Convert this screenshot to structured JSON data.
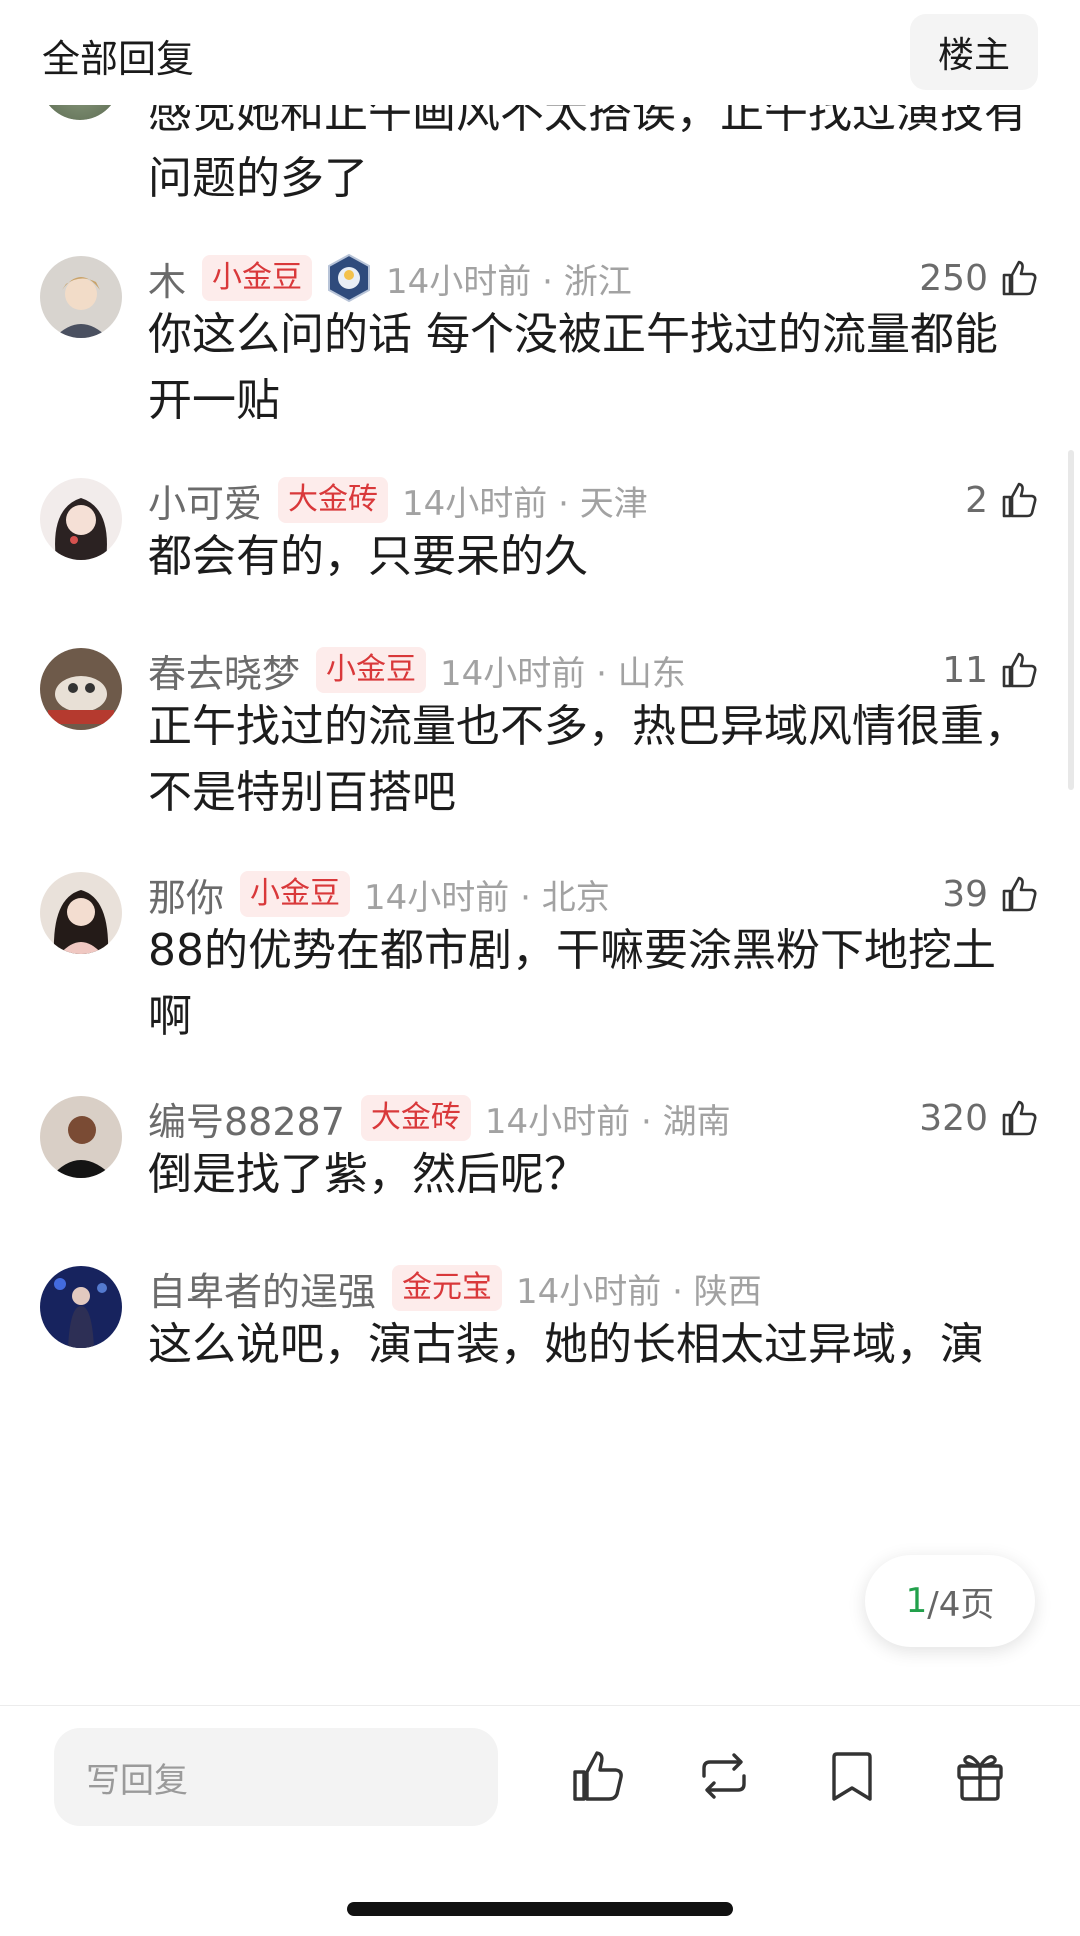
{
  "header": {
    "title": "全部回复",
    "op_button": "楼主"
  },
  "prev_comment": {
    "text": "感觉她和正午画风不太搭诶，正午找过演技有问题的多了"
  },
  "comments": [
    {
      "name": "木",
      "badge": "小金豆",
      "has_medal": true,
      "time_location": "14小时前 · 浙江",
      "likes": "250",
      "text": "你这么问的话 每个没被正午找过的流量都能开一贴"
    },
    {
      "name": "小可爱",
      "badge": "大金砖",
      "time_location": "14小时前 · 天津",
      "likes": "2",
      "text": "都会有的，只要呆的久"
    },
    {
      "name": "春去晓梦",
      "badge": "小金豆",
      "time_location": "14小时前 · 山东",
      "likes": "11",
      "text": "正午找过的流量也不多，热巴异域风情很重，不是特别百搭吧"
    },
    {
      "name": "那你",
      "badge": "小金豆",
      "time_location": "14小时前 · 北京",
      "likes": "39",
      "text": "88的优势在都市剧，干嘛要涂黑粉下地挖土啊"
    },
    {
      "name": "编号88287",
      "badge": "大金砖",
      "time_location": "14小时前 · 湖南",
      "likes": "320",
      "text": "倒是找了紫，然后呢？"
    },
    {
      "name": "自卑者的逞强",
      "badge": "金元宝",
      "time_location": "14小时前 · 陕西",
      "likes": "",
      "text": "这么说吧，演古装，她的长相太过异域，演"
    }
  ],
  "pager": {
    "current": "1",
    "total": "/4页"
  },
  "bottom_bar": {
    "reply_placeholder": "写回复"
  },
  "colors": {
    "badge_bg": "#fdeceb",
    "badge_text": "#d9383a",
    "pager_current": "#22a04b"
  }
}
